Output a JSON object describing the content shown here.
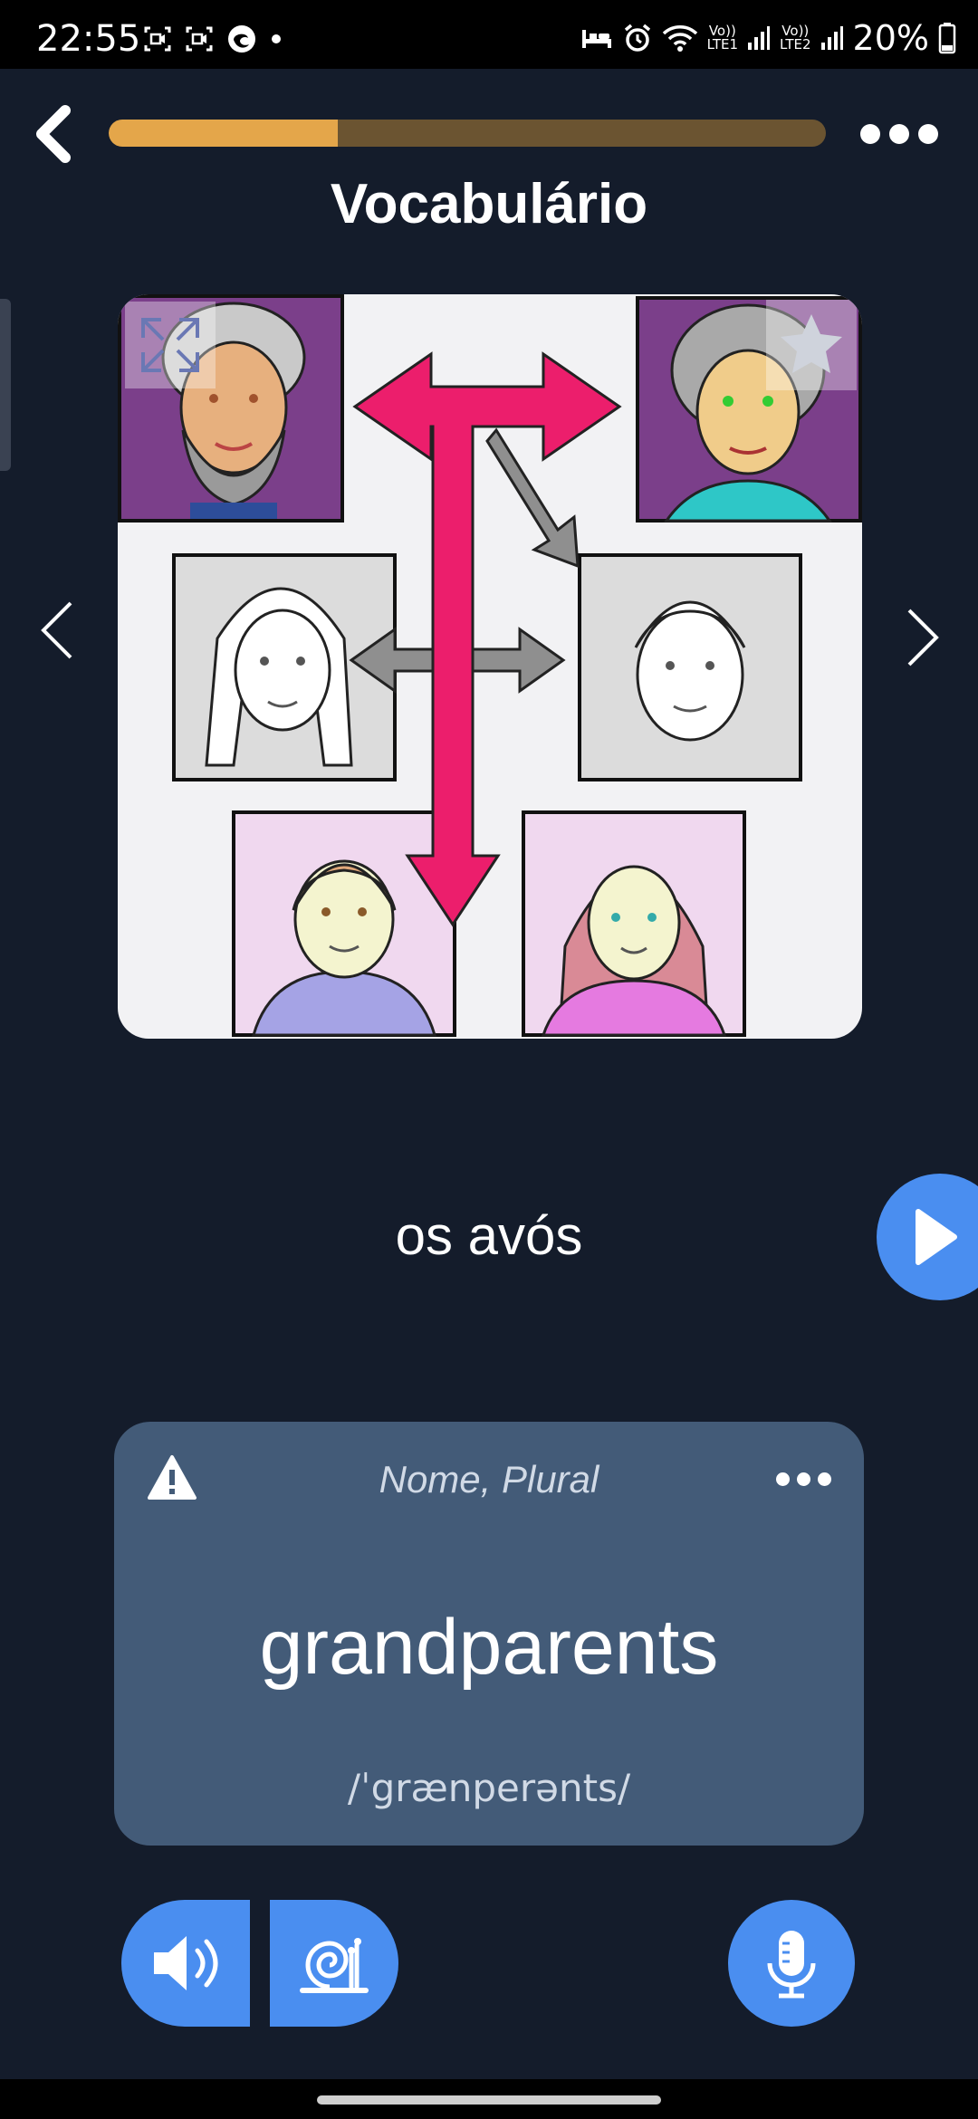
{
  "status_bar": {
    "time": "22:55",
    "lte1": "LTE1",
    "lte2": "LTE2",
    "volte1": "Vo))",
    "volte2": "Vo))",
    "battery": "20%",
    "icons": [
      "screen-record-icon",
      "screen-capture-icon",
      "edge-icon",
      "notification-dot-icon",
      "sleep-icon",
      "alarm-icon",
      "wifi-icon",
      "signal-icon",
      "signal-icon",
      "battery-icon"
    ]
  },
  "header": {
    "progress": 0.32,
    "progress_color": "#e4a64a",
    "progress_track_color": "#6b5431"
  },
  "title": "Vocabulário",
  "word": "os avós",
  "translation_card": {
    "part_of_speech": "Nome, Plural",
    "translation": "grandparents",
    "phonetic": "/ˈgrænperənts/"
  },
  "colors": {
    "background": "#141c2b",
    "accent": "#4a8ef0",
    "card": "#435b78",
    "arrow_pink": "#ec1e6c",
    "arrow_gray": "#8f8f8f"
  }
}
